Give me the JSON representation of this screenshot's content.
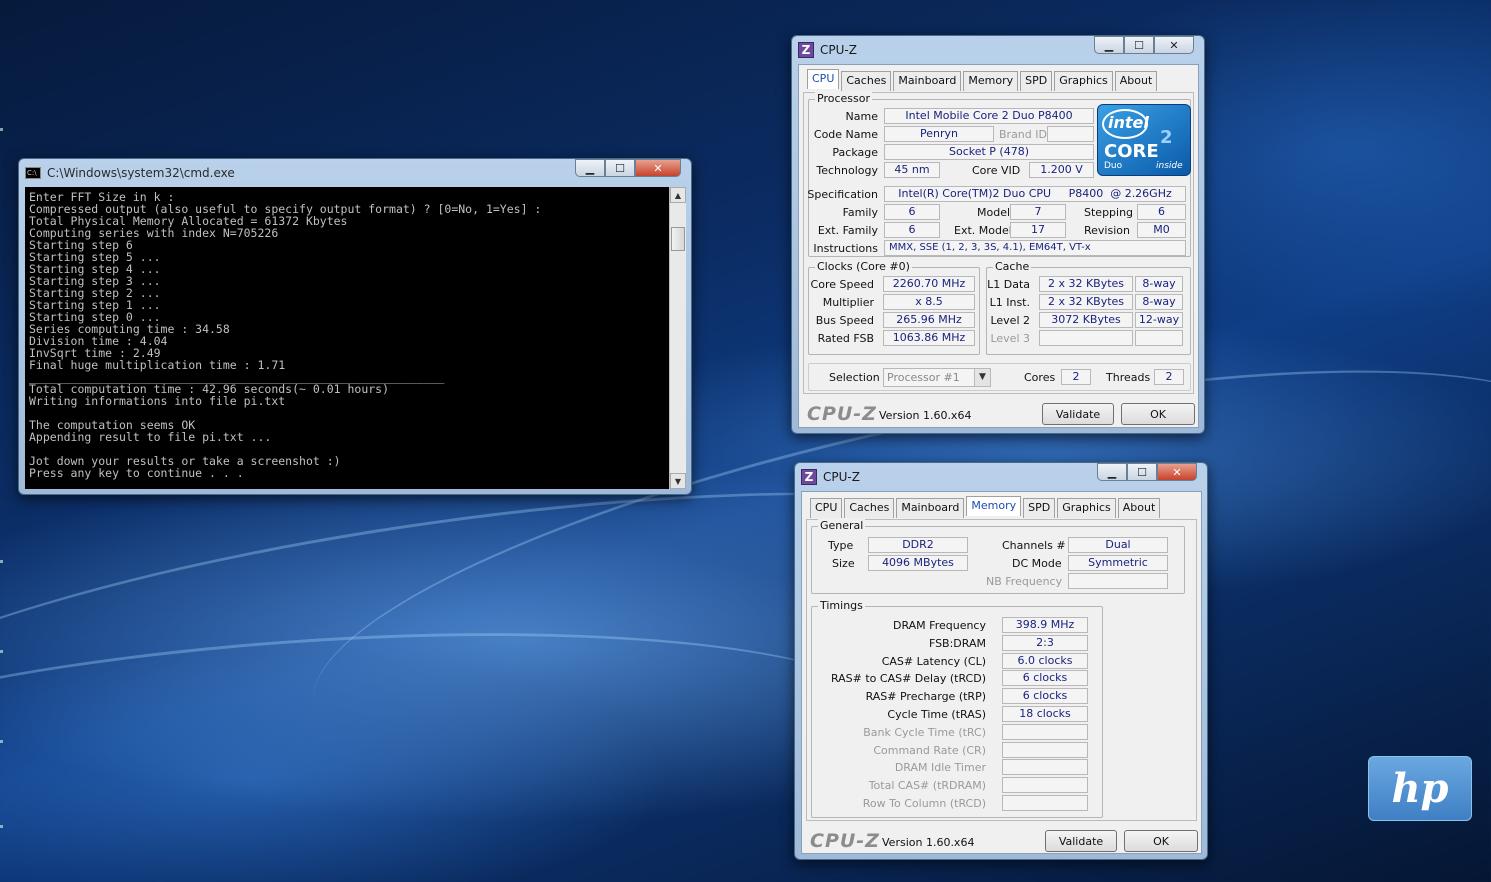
{
  "cmd": {
    "title": "C:\\Windows\\system32\\cmd.exe",
    "lines": [
      "Enter FFT Size in k :",
      "Compressed output (also useful to specify output format) ? [0=No, 1=Yes] :",
      "Total Physical Memory Allocated = 61372 Kbytes",
      "Computing series with index N=705226",
      "Starting step 6",
      "Starting step 5 ...",
      "Starting step 4 ...",
      "Starting step 3 ...",
      "Starting step 2 ...",
      "Starting step 1 ...",
      "Starting step 0 ...",
      "Series computing time : 34.58",
      "Division time : 4.04",
      "InvSqrt time : 2.49",
      "Final huge multiplication time : 1.71",
      "____________________________________________________________",
      "Total computation time : 42.96 seconds(~ 0.01 hours)",
      "Writing informations into file pi.txt",
      "",
      "The computation seems OK",
      "Appending result to file pi.txt ...",
      "",
      "Jot down your results or take a screenshot :)",
      "Press any key to continue . . ."
    ]
  },
  "cpuz_cpu": {
    "title": "CPU-Z",
    "tabs": [
      "CPU",
      "Caches",
      "Mainboard",
      "Memory",
      "SPD",
      "Graphics",
      "About"
    ],
    "active_tab": "CPU",
    "processor_legend": "Processor",
    "name_label": "Name",
    "name": "Intel Mobile Core 2 Duo P8400",
    "codename_label": "Code Name",
    "codename": "Penryn",
    "brandid_label": "Brand ID",
    "brandid": "",
    "package_label": "Package",
    "package": "Socket P (478)",
    "technology_label": "Technology",
    "technology": "45 nm",
    "corevid_label": "Core VID",
    "corevid": "1.200 V",
    "spec_label": "Specification",
    "spec": "Intel(R) Core(TM)2 Duo CPU     P8400  @ 2.26GHz",
    "family_label": "Family",
    "family": "6",
    "model_label": "Model",
    "model": "7",
    "stepping_label": "Stepping",
    "stepping": "6",
    "extfamily_label": "Ext. Family",
    "extfamily": "6",
    "extmodel_label": "Ext. Model",
    "extmodel": "17",
    "revision_label": "Revision",
    "revision": "M0",
    "instructions_label": "Instructions",
    "instructions": "MMX, SSE (1, 2, 3, 3S, 4.1), EM64T, VT-x",
    "logo": {
      "brand": "intel",
      "line": "CORE",
      "sub": "Duo",
      "inside": "inside",
      "badge": "2"
    },
    "clocks_legend": "Clocks (Core #0)",
    "corespeed_label": "Core Speed",
    "corespeed": "2260.70 MHz",
    "multiplier_label": "Multiplier",
    "multiplier": "x 8.5",
    "busspeed_label": "Bus Speed",
    "busspeed": "265.96 MHz",
    "ratedfsb_label": "Rated FSB",
    "ratedfsb": "1063.86 MHz",
    "cache_legend": "Cache",
    "l1data_label": "L1 Data",
    "l1data": "2 x 32 KBytes",
    "l1data_way": "8-way",
    "l1inst_label": "L1 Inst.",
    "l1inst": "2 x 32 KBytes",
    "l1inst_way": "8-way",
    "level2_label": "Level 2",
    "level2": "3072 KBytes",
    "level2_way": "12-way",
    "level3_label": "Level 3",
    "selection_label": "Selection",
    "selection": "Processor #1",
    "cores_label": "Cores",
    "cores": "2",
    "threads_label": "Threads",
    "threads": "2",
    "footer_logo": "CPU-Z",
    "version": "Version 1.60.x64",
    "validate": "Validate",
    "ok": "OK"
  },
  "cpuz_mem": {
    "title": "CPU-Z",
    "tabs": [
      "CPU",
      "Caches",
      "Mainboard",
      "Memory",
      "SPD",
      "Graphics",
      "About"
    ],
    "active_tab": "Memory",
    "general_legend": "General",
    "type_label": "Type",
    "type": "DDR2",
    "size_label": "Size",
    "size": "4096 MBytes",
    "channels_label": "Channels #",
    "channels": "Dual",
    "dcmode_label": "DC Mode",
    "dcmode": "Symmetric",
    "nbfreq_label": "NB Frequency",
    "timings_legend": "Timings",
    "timings": [
      {
        "label": "DRAM Frequency",
        "value": "398.9 MHz",
        "dim": false
      },
      {
        "label": "FSB:DRAM",
        "value": "2:3",
        "dim": false
      },
      {
        "label": "CAS# Latency (CL)",
        "value": "6.0 clocks",
        "dim": false
      },
      {
        "label": "RAS# to CAS# Delay (tRCD)",
        "value": "6 clocks",
        "dim": false
      },
      {
        "label": "RAS# Precharge (tRP)",
        "value": "6 clocks",
        "dim": false
      },
      {
        "label": "Cycle Time (tRAS)",
        "value": "18 clocks",
        "dim": false
      },
      {
        "label": "Bank Cycle Time (tRC)",
        "value": "",
        "dim": true
      },
      {
        "label": "Command Rate (CR)",
        "value": "",
        "dim": true
      },
      {
        "label": "DRAM Idle Timer",
        "value": "",
        "dim": true
      },
      {
        "label": "Total CAS# (tRDRAM)",
        "value": "",
        "dim": true
      },
      {
        "label": "Row To Column (tRCD)",
        "value": "",
        "dim": true
      }
    ],
    "footer_logo": "CPU-Z",
    "version": "Version 1.60.x64",
    "validate": "Validate",
    "ok": "OK"
  },
  "desktop": {
    "hp_logo": "hp"
  }
}
